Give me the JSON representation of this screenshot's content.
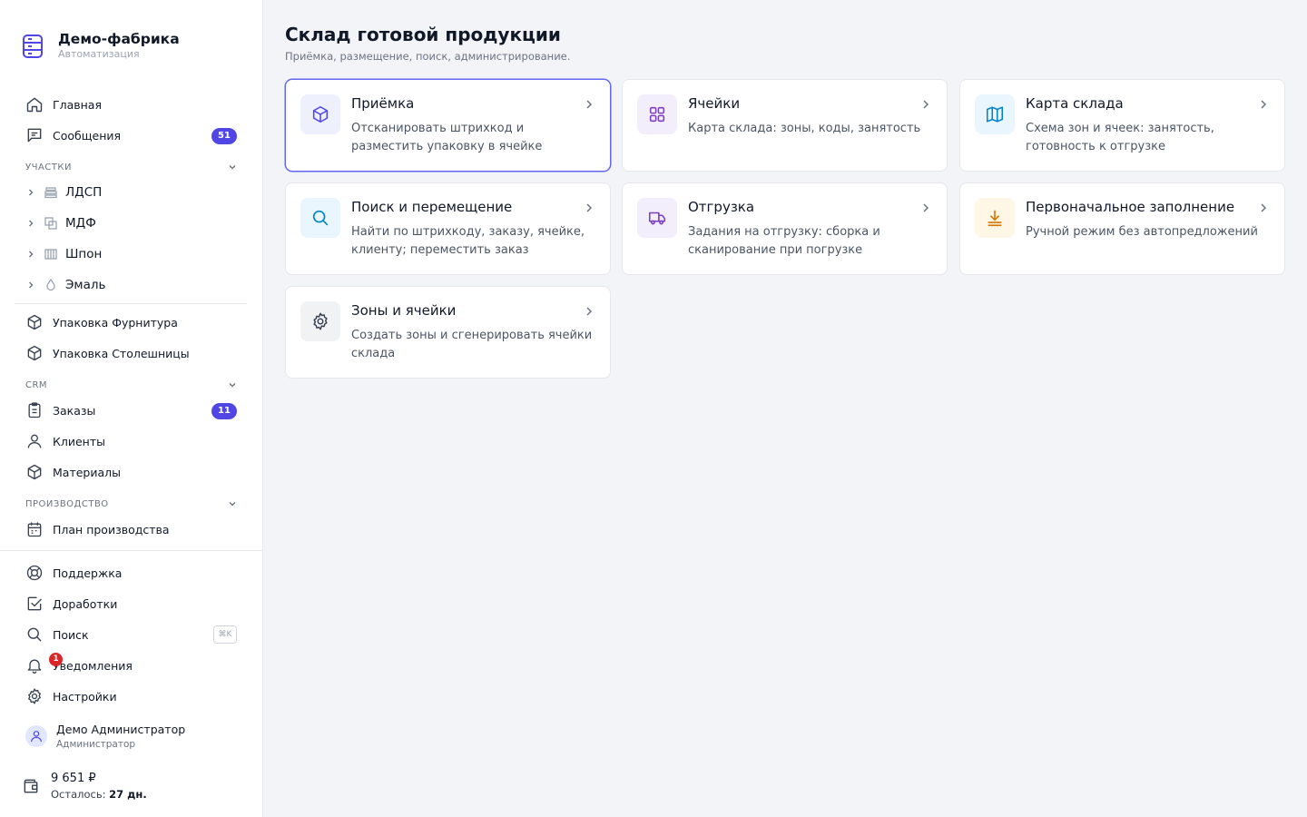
{
  "brand": {
    "name": "Демо-фабрика",
    "subtitle": "Автоматизация"
  },
  "sidebar": {
    "home": {
      "label": "Главная",
      "icon": "home-icon"
    },
    "messages": {
      "label": "Сообщения",
      "badge": "51",
      "icon": "message-icon"
    },
    "sections": {
      "areas": "УЧАСТКИ",
      "crm": "CRM",
      "production": "ПРОИЗВОДСТВО"
    },
    "areas": [
      {
        "label": "ЛДСП",
        "icon": "layers-icon"
      },
      {
        "label": "МДФ",
        "icon": "squares-icon"
      },
      {
        "label": "Шпон",
        "icon": "veneer-icon"
      },
      {
        "label": "Эмаль",
        "icon": "drop-icon"
      }
    ],
    "packaging": [
      {
        "label": "Упаковка Фурнитура"
      },
      {
        "label": "Упаковка Столешницы"
      }
    ],
    "crm_items": [
      {
        "label": "Заказы",
        "badge": "11"
      },
      {
        "label": "Клиенты"
      },
      {
        "label": "Материалы"
      }
    ],
    "production_items": [
      {
        "label": "План производства"
      }
    ],
    "bottom": {
      "support": "Поддержка",
      "improvements": "Доработки",
      "search": "Поиск",
      "search_shortcut": "⌘K",
      "notifications": "Уведомления",
      "notifications_count": "1",
      "settings": "Настройки"
    },
    "user": {
      "name": "Демо Администратор",
      "role": "Администратор"
    },
    "balance": {
      "amount": "9 651 ₽",
      "rest_label": "Осталось:",
      "rest_value": "27 дн."
    }
  },
  "main": {
    "title": "Склад готовой продукции",
    "subtitle": "Приёмка, размещение, поиск, администрирование.",
    "cards": [
      {
        "title": "Приёмка",
        "desc": "Отсканировать штрихкод и разместить упаковку в ячейке",
        "icon": "box-icon",
        "active": true
      },
      {
        "title": "Ячейки",
        "desc": "Карта склада: зоны, коды, занятость",
        "icon": "grid-icon"
      },
      {
        "title": "Карта склада",
        "desc": "Схема зон и ячеек: занятость, готовность к отгрузке",
        "icon": "map-icon"
      },
      {
        "title": "Поиск и перемещение",
        "desc": "Найти по штрихкоду, заказу, ячейке, клиенту; переместить заказ",
        "icon": "search-icon"
      },
      {
        "title": "Отгрузка",
        "desc": "Задания на отгрузку: сборка и сканирование при погрузке",
        "icon": "truck-icon"
      },
      {
        "title": "Первоначальное заполнение",
        "desc": "Ручной режим без автопредложений",
        "icon": "download-icon"
      },
      {
        "title": "Зоны и ячейки",
        "desc": "Создать зоны и сгенерировать ячейки склада",
        "icon": "gear-icon"
      }
    ]
  },
  "colors": {
    "accent": "#4f46e5",
    "card_icon_bg_indigo": "#eef0fd",
    "card_icon_bg_purple": "#f3eefc",
    "card_icon_bg_sky": "#eaf6fd",
    "card_icon_bg_amber": "#fef7e6",
    "card_icon_bg_gray": "#f1f2f4"
  }
}
